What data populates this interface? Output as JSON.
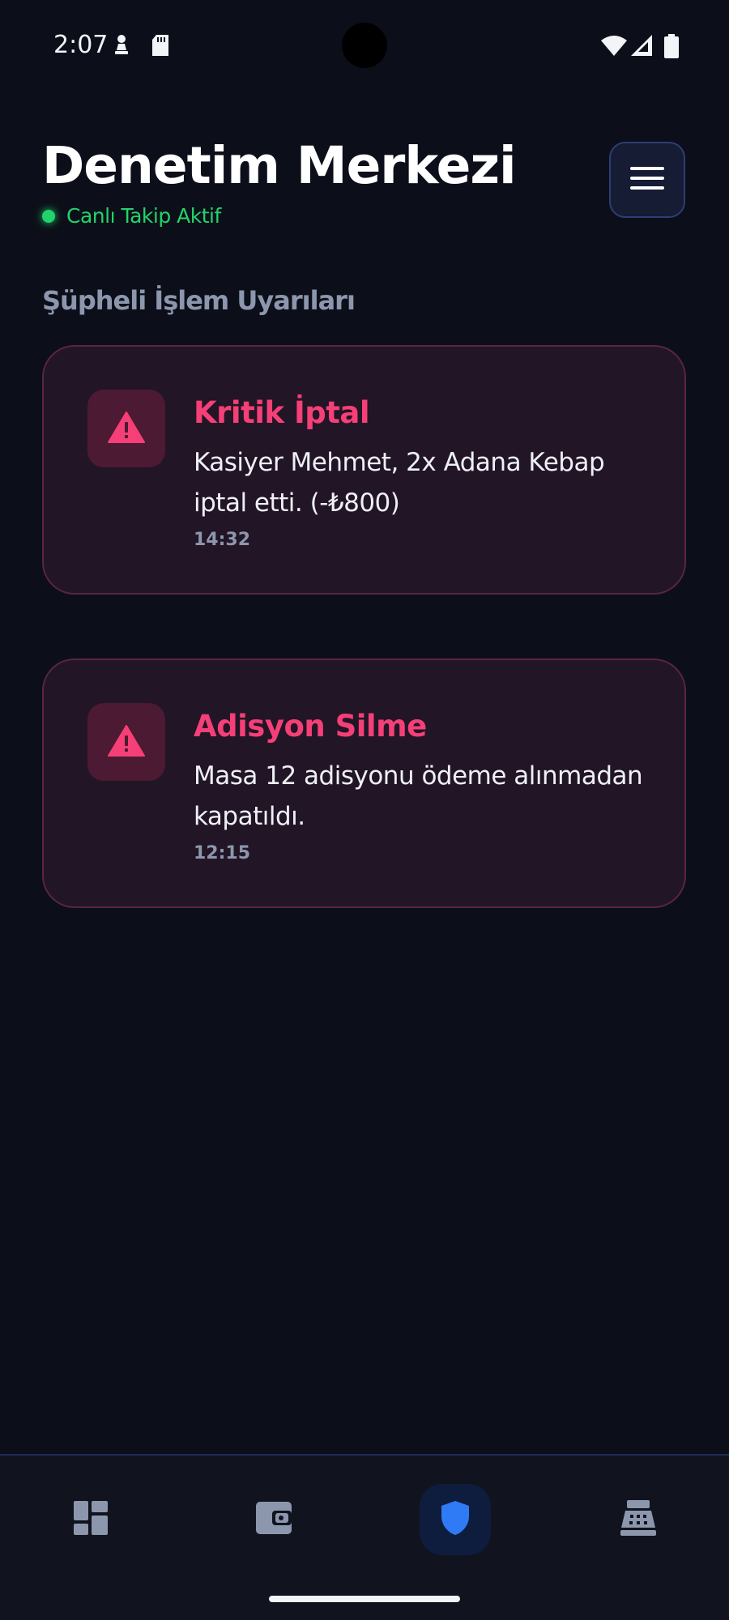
{
  "status_bar": {
    "time": "2:07",
    "icons": [
      "chess-pawn-icon",
      "sd-card-icon",
      "wifi-icon",
      "signal-icon",
      "battery-icon"
    ]
  },
  "header": {
    "title": "Denetim Merkezi",
    "live_status": "Canlı Takip Aktif",
    "menu_icon": "hamburger-menu-icon"
  },
  "section": {
    "title": "Şüpheli İşlem Uyarıları"
  },
  "alerts": [
    {
      "title": "Kritik İptal",
      "description": "Kasiyer Mehmet, 2x Adana Kebap iptal etti. (-₺800)",
      "time": "14:32",
      "icon": "warning-icon"
    },
    {
      "title": "Adisyon Silme",
      "description": "Masa 12 adisyonu ödeme alınmadan kapatıldı.",
      "time": "12:15",
      "icon": "warning-icon"
    }
  ],
  "bottom_nav": {
    "items": [
      {
        "icon": "dashboard-icon",
        "active": false
      },
      {
        "icon": "wallet-icon",
        "active": false
      },
      {
        "icon": "shield-icon",
        "active": true
      },
      {
        "icon": "cash-register-icon",
        "active": false
      }
    ]
  },
  "colors": {
    "background": "#0c0f19",
    "accent_green": "#22d36b",
    "alert_red": "#f53f77",
    "active_blue": "#2f7bf5"
  }
}
